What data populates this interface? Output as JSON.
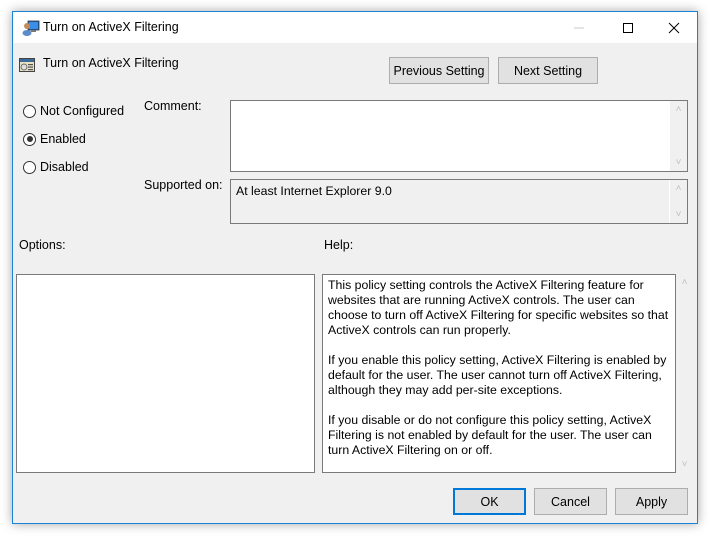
{
  "window": {
    "title": "Turn on ActiveX Filtering",
    "controls": {
      "minimize": "minimize",
      "maximize": "maximize",
      "close": "close"
    }
  },
  "header": {
    "policy_title": "Turn on ActiveX Filtering",
    "previous_label": "Previous Setting",
    "next_label": "Next Setting"
  },
  "state": {
    "options": [
      {
        "label": "Not Configured",
        "checked": false
      },
      {
        "label": "Enabled",
        "checked": true
      },
      {
        "label": "Disabled",
        "checked": false
      }
    ]
  },
  "comment": {
    "label": "Comment:",
    "value": ""
  },
  "supported": {
    "label": "Supported on:",
    "value": "At least Internet Explorer 9.0"
  },
  "options_panel": {
    "label": "Options:"
  },
  "help_panel": {
    "label": "Help:",
    "paragraphs": [
      "This policy setting controls the ActiveX Filtering feature for websites that are running ActiveX controls. The user can choose to turn off ActiveX Filtering for specific websites so that ActiveX controls can run properly.",
      "If you enable this policy setting, ActiveX Filtering is enabled by default for the user. The user cannot turn off ActiveX Filtering, although they may add per-site exceptions.",
      "If you disable or do not configure this policy setting, ActiveX Filtering is not enabled by default for the user. The user can turn ActiveX Filtering on or off."
    ]
  },
  "footer": {
    "ok_label": "OK",
    "cancel_label": "Cancel",
    "apply_label": "Apply"
  },
  "colors": {
    "accent": "#0078d7",
    "window_border": "#1883d7",
    "dialog_bg": "#f0f0f0"
  }
}
